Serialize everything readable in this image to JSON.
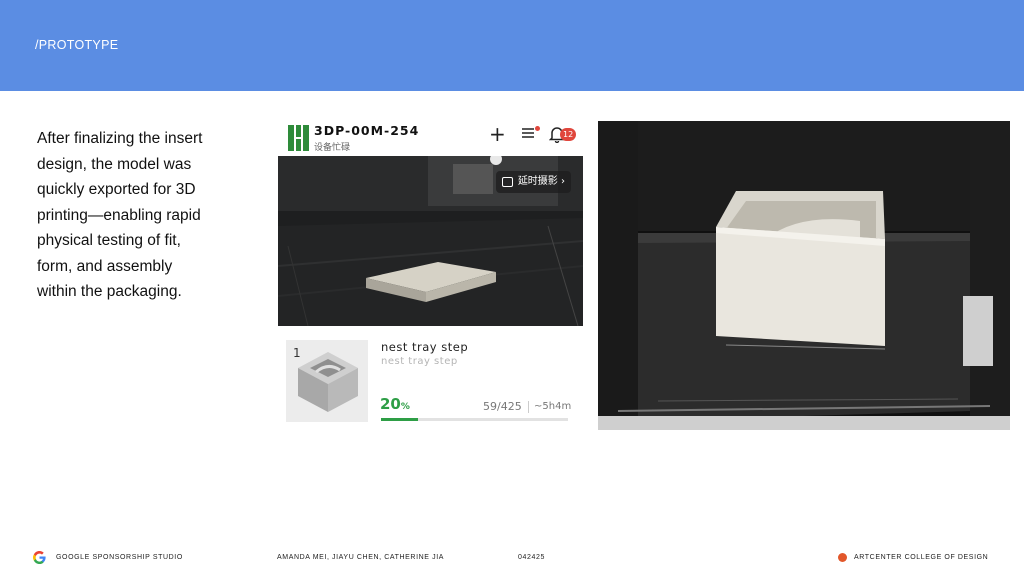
{
  "header": {
    "section_label": "/PROTOTYPE",
    "accent_color": "#5b8de3"
  },
  "body": {
    "lines": [
      "After finalizing the insert",
      "design, the model was",
      "quickly exported for 3D",
      "printing—enabling rapid",
      "physical testing of fit,",
      "form, and assembly",
      "within the packaging."
    ]
  },
  "app": {
    "device_id": "3DP-00M-254",
    "device_status": "设备忙碌",
    "icons": [
      "plus-icon",
      "menu-icon",
      "bell-icon"
    ],
    "notification_count": "12",
    "camera": {
      "timelapse_label": "延时摄影 ›"
    },
    "job": {
      "plate_number": "1",
      "name": "nest tray step",
      "subtitle": "nest tray step",
      "progress_value": "20",
      "progress_unit": "%",
      "progress_fraction": 0.2,
      "layers": "59/425",
      "time_remaining": "~5h4m",
      "progress_color": "#2e9e46"
    }
  },
  "footer": {
    "left": "GOOGLE SPONSORSHIP STUDIO",
    "authors": "AMANDA MEI, JIAYU CHEN, CATHERINE JIA",
    "code": "042425",
    "right": "ARTCENTER COLLEGE OF DESIGN",
    "dot_color": "#e2572a"
  }
}
